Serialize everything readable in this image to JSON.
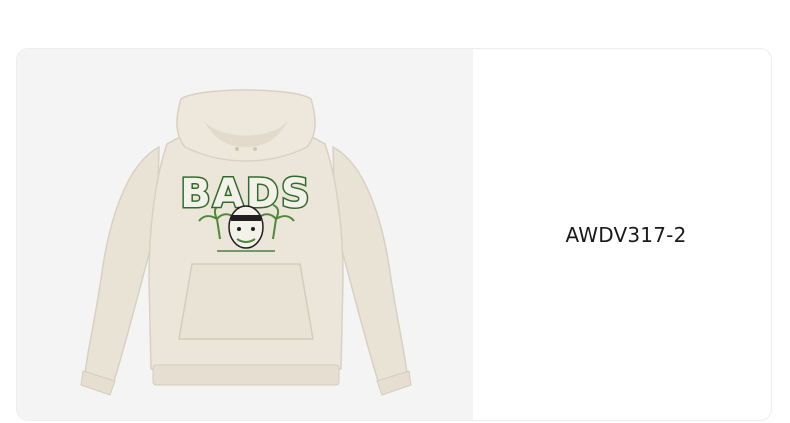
{
  "product": {
    "sku": "AWDV317-2",
    "image": {
      "subject": "hoodie-illustration",
      "garment_color": "#ece6da",
      "print_colors": [
        "#2f6b2a",
        "#4c8a3a",
        "#1f1f1f"
      ],
      "print_text": "BADS"
    }
  },
  "colors": {
    "card_border": "#ededed",
    "image_bg": "#f4f4f4",
    "text": "#1a1a1a"
  }
}
